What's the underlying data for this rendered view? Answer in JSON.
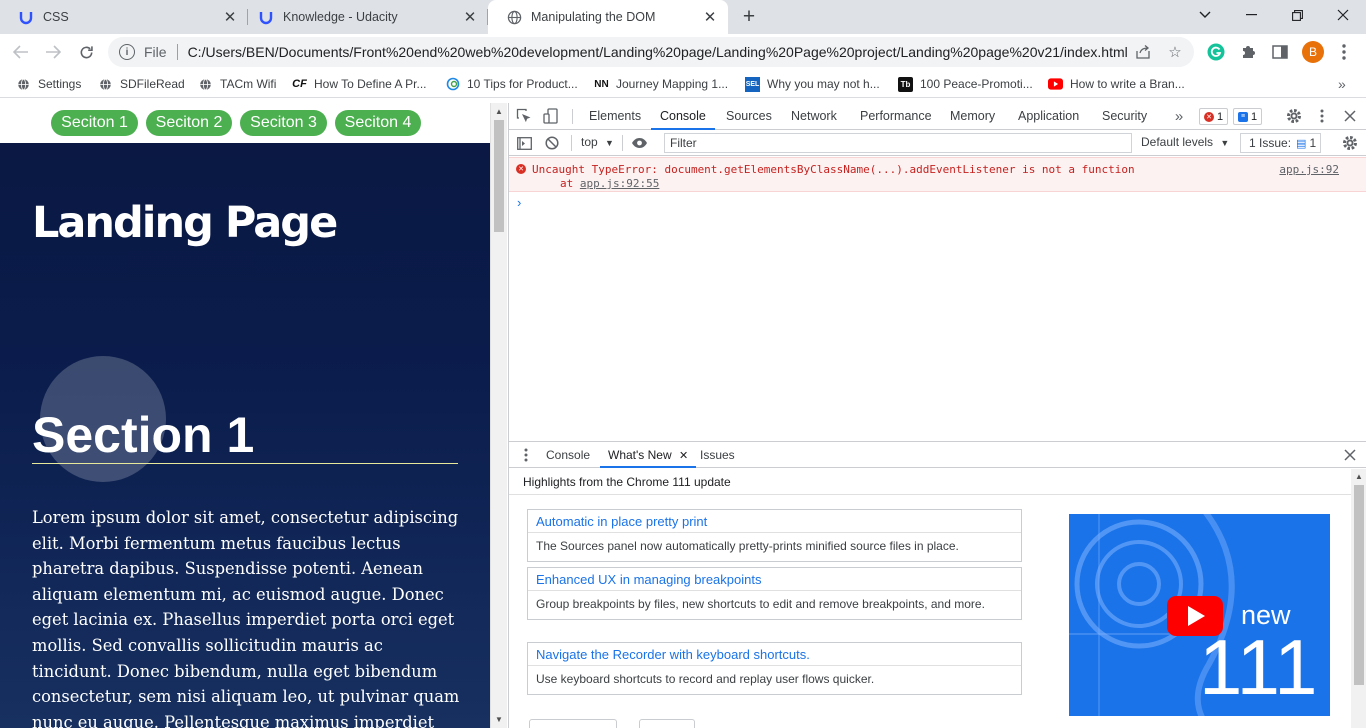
{
  "tabs": [
    {
      "title": "CSS",
      "icon": "udacity-icon"
    },
    {
      "title": "Knowledge - Udacity",
      "icon": "udacity-icon"
    },
    {
      "title": "Manipulating the DOM",
      "icon": "globe-icon"
    }
  ],
  "toolbar": {
    "scheme": "File",
    "url": "C:/Users/BEN/Documents/Front%20end%20web%20development/Landing%20page/Landing%20Page%20project/Landing%20page%20v21/index.html",
    "profile_initial": "B"
  },
  "bookmarks": [
    {
      "label": "Settings",
      "icon": "globe-icon"
    },
    {
      "label": "SDFileRead",
      "icon": "globe-icon"
    },
    {
      "label": "TACm Wifi",
      "icon": "globe-icon"
    },
    {
      "label": "How To Define A Pr...",
      "icon": "cf-icon"
    },
    {
      "label": "10 Tips for Product...",
      "icon": "swirl-icon"
    },
    {
      "label": "Journey Mapping 1...",
      "icon": "nn-icon"
    },
    {
      "label": "Why you may not h...",
      "icon": "sel-icon"
    },
    {
      "label": "100 Peace-Promoti...",
      "icon": "tb-icon"
    },
    {
      "label": "How to write a Bran...",
      "icon": "youtube-icon"
    }
  ],
  "page": {
    "nav": [
      "Seciton 1",
      "Seciton 2",
      "Seciton 3",
      "Seciton 4"
    ],
    "heading": "Landing Page",
    "section_title": "Section 1",
    "lorem": "Lorem ipsum dolor sit amet, consectetur adipiscing elit. Morbi fermentum metus faucibus lectus pharetra dapibus. Suspendisse potenti. Aenean aliquam elementum mi, ac euismod augue. Donec eget lacinia ex. Phasellus imperdiet porta orci eget mollis. Sed convallis sollicitudin mauris ac tincidunt. Donec bibendum, nulla eget bibendum consectetur, sem nisi aliquam leo, ut pulvinar quam nunc eu augue. Pellentesque maximus imperdiet elit a pharetra. Duis"
  },
  "devtools": {
    "tabs": [
      "Elements",
      "Console",
      "Sources",
      "Network",
      "Performance",
      "Memory",
      "Application",
      "Security"
    ],
    "active_tab": "Console",
    "error_count": "1",
    "message_count": "1",
    "console": {
      "context": "top",
      "filter_placeholder": "Filter",
      "levels": "Default levels",
      "issues_label": "1 Issue:",
      "issues_count": "1",
      "error_line1": "Uncaught TypeError: document.getElementsByClassName(...).addEventListener is not a function",
      "error_line2_prefix": "at ",
      "error_line2_link": "app.js:92:55",
      "error_source": "app.js:92"
    },
    "drawer": {
      "tabs": [
        "Console",
        "What's New",
        "Issues"
      ],
      "highlights": "Highlights from the Chrome 111 update",
      "cards": [
        {
          "title": "Automatic in place pretty print",
          "desc": "The Sources panel now automatically pretty-prints minified source files in place."
        },
        {
          "title": "Enhanced UX in managing breakpoints",
          "desc": "Group breakpoints by files, new shortcuts to edit and remove breakpoints, and more."
        },
        {
          "title": "Navigate the Recorder with keyboard shortcuts.",
          "desc": "Use keyboard shortcuts to record and replay user flows quicker."
        }
      ],
      "promo": {
        "label": "new",
        "version": "111"
      }
    }
  },
  "colors": {
    "accent": "#1a73e8",
    "nav_button": "#4caf50",
    "error_text": "#c5221f",
    "page_bg": "#0b1d4d",
    "profile": "#e8710a"
  }
}
